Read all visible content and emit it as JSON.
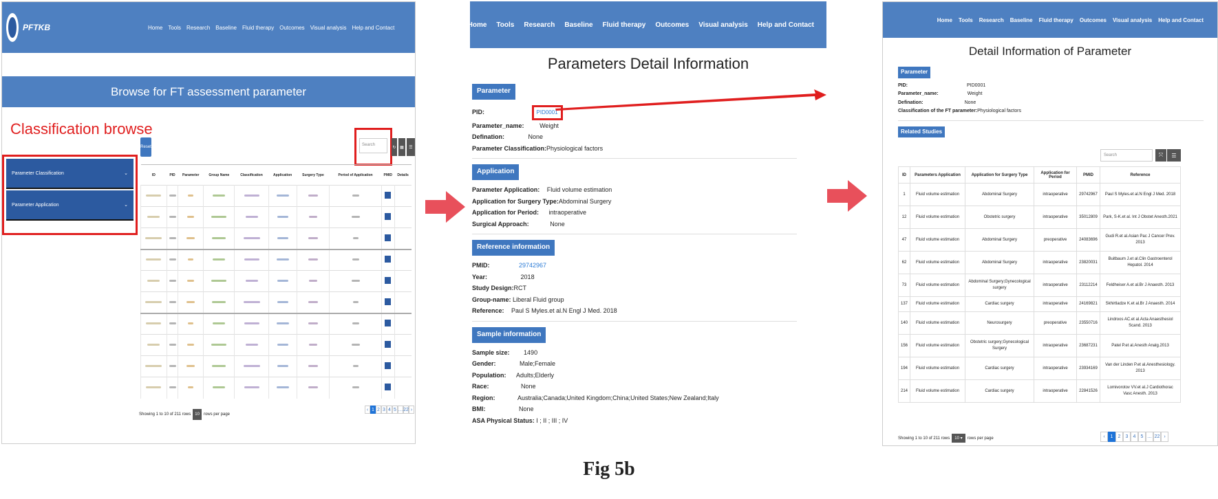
{
  "panel1": {
    "logo_text": "PFTKB",
    "nav": [
      "Home",
      "Tools",
      "Research",
      "Baseline",
      "Fluid therapy",
      "Outcomes",
      "Visual analysis",
      "Help and Contact"
    ],
    "banner_title": "Browse for FT assessment parameter",
    "classification_label": "Classification browse",
    "sidebar": [
      "Parameter Classification",
      "Parameter Application"
    ],
    "reset_label": "Reset",
    "search_placeholder": "Search",
    "columns": [
      "ID",
      "PID",
      "Parameter",
      "Group Name",
      "Classification",
      "Application",
      "Surgery Type",
      "Period of Application",
      "PMID",
      "Details"
    ],
    "pmid_btn": "detail",
    "showing": "Showing 1 to 10 of 211 rows",
    "per_page_value": "10",
    "per_page_text": "rows per page",
    "pages": [
      "‹",
      "1",
      "2",
      "3",
      "4",
      "5",
      "…",
      "22",
      "›"
    ]
  },
  "panel2": {
    "nav": [
      "Home",
      "Tools",
      "Research",
      "Baseline",
      "Fluid therapy",
      "Outcomes",
      "Visual analysis",
      "Help and Contact"
    ],
    "title": "Parameters Detail Information",
    "sec_parameter": "Parameter",
    "pid_label": "PID:",
    "pid_value": "PID0001",
    "pname_label": "Parameter_name:",
    "pname_value": "Weight",
    "def_label": "Defination:",
    "def_value": "None",
    "pclass_label": "Parameter Classification:",
    "pclass_value": "Physiological factors",
    "sec_application": "Application",
    "papp_label": "Parameter Application:",
    "papp_value": "Fluid volume estimation",
    "surg_label": "Application for Surgery Type:",
    "surg_value": "Abdominal Surgery",
    "period_label": "Application for Period:",
    "period_value": "intraoperative",
    "approach_label": "Surgical Approach:",
    "approach_value": "None",
    "sec_reference": "Reference information",
    "pmid_label": "PMID:",
    "pmid_value": "29742967",
    "year_label": "Year:",
    "year_value": "2018",
    "design_label": "Study Design:",
    "design_value": "RCT",
    "group_label": "Group-name:",
    "group_value": "Liberal Fluid group",
    "ref_label": "Reference:",
    "ref_value": "Paul S Myles.et al.N Engl J Med. 2018",
    "sec_sample": "Sample information",
    "size_label": "Sample size:",
    "size_value": "1490",
    "gender_label": "Gender:",
    "gender_value": "Male;Female",
    "pop_label": "Population:",
    "pop_value": "Adults;Elderly",
    "race_label": "Race:",
    "race_value": "None",
    "region_label": "Region:",
    "region_value": "Australia;Canada;United Kingdom;China;United States;New Zealand;Italy",
    "bmi_label": "BMI:",
    "bmi_value": "None",
    "asa_label": "ASA Physical Status:",
    "asa_value": "I ; II ; III ; IV"
  },
  "panel3": {
    "nav": [
      "Home",
      "Tools",
      "Research",
      "Baseline",
      "Fluid therapy",
      "Outcomes",
      "Visual analysis",
      "Help and Contact"
    ],
    "title": "Detail Information of Parameter",
    "sec_parameter": "Parameter",
    "pid_label": "PID:",
    "pid_value": "PID0001",
    "pname_label": "Parameter_name:",
    "pname_value": "Weight",
    "def_label": "Defination:",
    "def_value": "None",
    "class_label": "Classification of the FT parameter:",
    "class_value": "Physiological factors",
    "sec_related": "Related Studies",
    "search_placeholder": "Search",
    "columns": [
      "ID",
      "Parameters Application",
      "Application for Surgery Type",
      "Application for Period",
      "PMID",
      "Reference"
    ],
    "rows": [
      [
        "1",
        "Fluid volume estimation",
        "Abdominal Surgery",
        "intraoperative",
        "29742967",
        "Paul S Myles.et al.N Engl J Med. 2018"
      ],
      [
        "12",
        "Fluid volume estimation",
        "Obstetric surgery",
        "intraoperative",
        "35012809",
        "Park, S-K.et al. Int J Obstet Anesth.2021"
      ],
      [
        "47",
        "Fluid volume estimation",
        "Abdominal Surgery",
        "preoperative",
        "24083696",
        "Gudi R.et al.Asian Pac J Cancer Prev. 2013"
      ],
      [
        "62",
        "Fluid volume estimation",
        "Abdominal Surgery",
        "intraoperative",
        "23820031",
        "Buitbaum J.et al.Clin Gastroenterol Hepatol. 2014"
      ],
      [
        "73",
        "Fluid volume estimation",
        "Abdominal Surgery;Gynecological surgery",
        "intraoperative",
        "23112214",
        "Feldheiser A.et al.Br J Anaesth. 2013"
      ],
      [
        "137",
        "Fluid volume estimation",
        "Cardiac surgery",
        "intraoperative",
        "24169821",
        "Skhirtladze K.et al.Br J Anaesth. 2014"
      ],
      [
        "140",
        "Fluid volume estimation",
        "Neurosurgery",
        "preoperative",
        "23550716",
        "Lindroos AC.et al.Acta Anaesthesiol Scand. 2013"
      ],
      [
        "156",
        "Fluid volume estimation",
        "Obstetric surgery;Gynecological Surgery",
        "intraoperative",
        "23687231",
        "Patel P.et al.Anesth Analg.2013"
      ],
      [
        "194",
        "Fluid volume estimation",
        "Cardiac surgery",
        "intraoperative",
        "23934169",
        "Van der Linden P.et al.Anesthesiology. 2013"
      ],
      [
        "214",
        "Fluid volume estimation",
        "Cardiac surgery",
        "intraoperative",
        "22841526",
        "Lomivorotov VV.et al.J Cardiothorac Vasc Anesth. 2013"
      ]
    ],
    "showing": "Showing 1 to 10 of 211 rows",
    "per_page_value": "10",
    "per_page_text": "rows per page",
    "pages": [
      "‹",
      "1",
      "2",
      "3",
      "4",
      "5",
      "…",
      "22",
      "›"
    ]
  },
  "caption": "Fig 5b",
  "colors": {
    "nav": "#4e80c1",
    "badge": "#3f77bf",
    "highlight": "#e01e1e",
    "arrow": "#e8505b",
    "link": "#2a7bd6"
  }
}
